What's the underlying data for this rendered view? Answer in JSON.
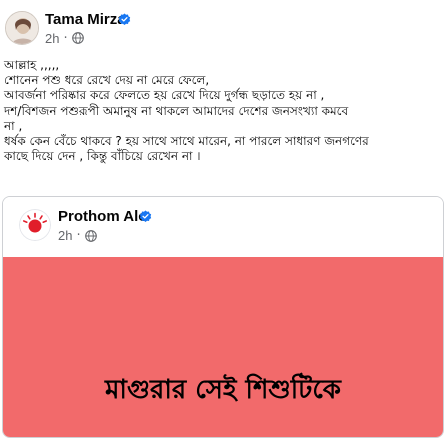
{
  "post": {
    "author_name": "Tama Mirza",
    "time": "2h",
    "separator": "·",
    "icons": {
      "verified": "verified-badge-icon",
      "audience": "globe-icon",
      "avatar": "profile-photo"
    },
    "body_lines": [
      "আল্লাহ ,,,,,",
      "শোনেন পশু ধরে রেখে দেয় না মেরে ফেলে,",
      "আবর্জনা পরিষ্কার করে ফেলতে হয় রেখে দিয়ে দুর্গন্ধ ছড়াতে হয় না ,",
      "দশ/বিশজন পশুরূপী অমানুষ না থাকলে আমাদের দেশের জনসংখ্যা কমবে",
      "না ,",
      "ধর্ষক কেন বেঁচে থাকবে ? হয় সাথে সাথে মারেন, না পারলে সাধারণ জনগণের",
      "কাছে দিয়ে দেন , কিন্তু বাঁচিয়ে রেখেন না ।"
    ]
  },
  "shared_post": {
    "page_name": "Prothom Alo",
    "time": "2h",
    "separator": "·",
    "headline_line1": "মাগুরার সেই শিশুটিকে",
    "colors": {
      "image_background": "#f26a6b",
      "logo_red": "#e11d2a",
      "verified_blue": "#1877f2"
    }
  }
}
